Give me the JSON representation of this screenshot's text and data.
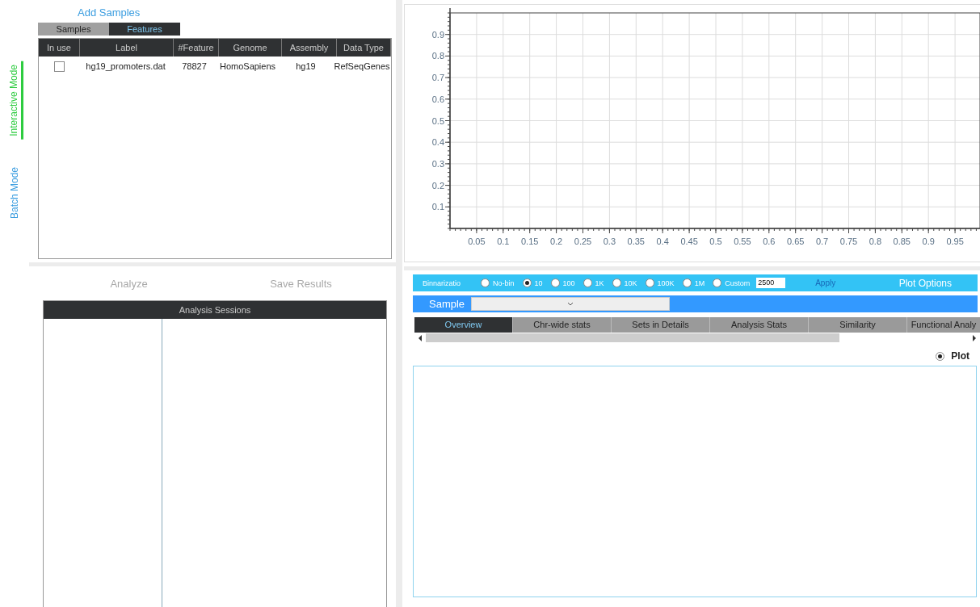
{
  "modes": [
    {
      "label": "Interactive Mode",
      "selected": true
    },
    {
      "label": "Batch Mode",
      "selected": false
    }
  ],
  "add_samples": "Add Samples",
  "source_tabs": [
    {
      "label": "Samples",
      "selected": false
    },
    {
      "label": "Features",
      "selected": true
    }
  ],
  "features_table": {
    "columns": [
      "In use",
      "Label",
      "#Feature",
      "Genome",
      "Assembly",
      "Data Type"
    ],
    "rows": [
      {
        "checked": false,
        "cells": [
          "",
          "hg19_promoters.dat",
          "78827",
          "HomoSapiens",
          "hg19",
          "RefSeqGenes"
        ]
      }
    ]
  },
  "actions": [
    {
      "label": "Analyze",
      "disabled": true
    },
    {
      "label": "Save Results",
      "disabled": true
    }
  ],
  "sessions": {
    "title": "Analysis Sessions"
  },
  "chart_data": {
    "type": "line",
    "grid": true,
    "xlim": [
      0,
      1
    ],
    "ylim": [
      0,
      1
    ],
    "xticks": [
      0.05,
      0.1,
      0.15,
      0.2,
      0.25,
      0.3,
      0.35,
      0.4,
      0.45,
      0.5,
      0.55,
      0.6,
      0.65,
      0.7,
      0.75,
      0.8,
      0.85,
      0.9,
      0.95
    ],
    "yticks": [
      0.1,
      0.2,
      0.3,
      0.4,
      0.5,
      0.6,
      0.7,
      0.8,
      0.9
    ]
  },
  "binning": {
    "label": "Binnarizatio",
    "options": [
      {
        "label": "No-bin",
        "selected": false
      },
      {
        "label": "10",
        "selected": true
      },
      {
        "label": "100",
        "selected": false
      },
      {
        "label": "1K",
        "selected": false
      },
      {
        "label": "10K",
        "selected": false
      },
      {
        "label": "100K",
        "selected": false
      },
      {
        "label": "1M",
        "selected": false
      },
      {
        "label": "Custom",
        "selected": false
      }
    ],
    "custom_value": "2500",
    "apply": {
      "label": "Apply",
      "disabled": true
    },
    "plot_options": "Plot Options"
  },
  "sample": {
    "label": "Sample"
  },
  "result_tabs": [
    {
      "label": "Overview",
      "selected": true
    },
    {
      "label": "Chr-wide stats",
      "selected": false
    },
    {
      "label": "Sets in Details",
      "selected": false
    },
    {
      "label": "Analysis Stats",
      "selected": false
    },
    {
      "label": "Similarity",
      "selected": false
    },
    {
      "label": "Functional Analy",
      "selected": false
    }
  ],
  "view": {
    "label": "Plot",
    "selected": true
  }
}
